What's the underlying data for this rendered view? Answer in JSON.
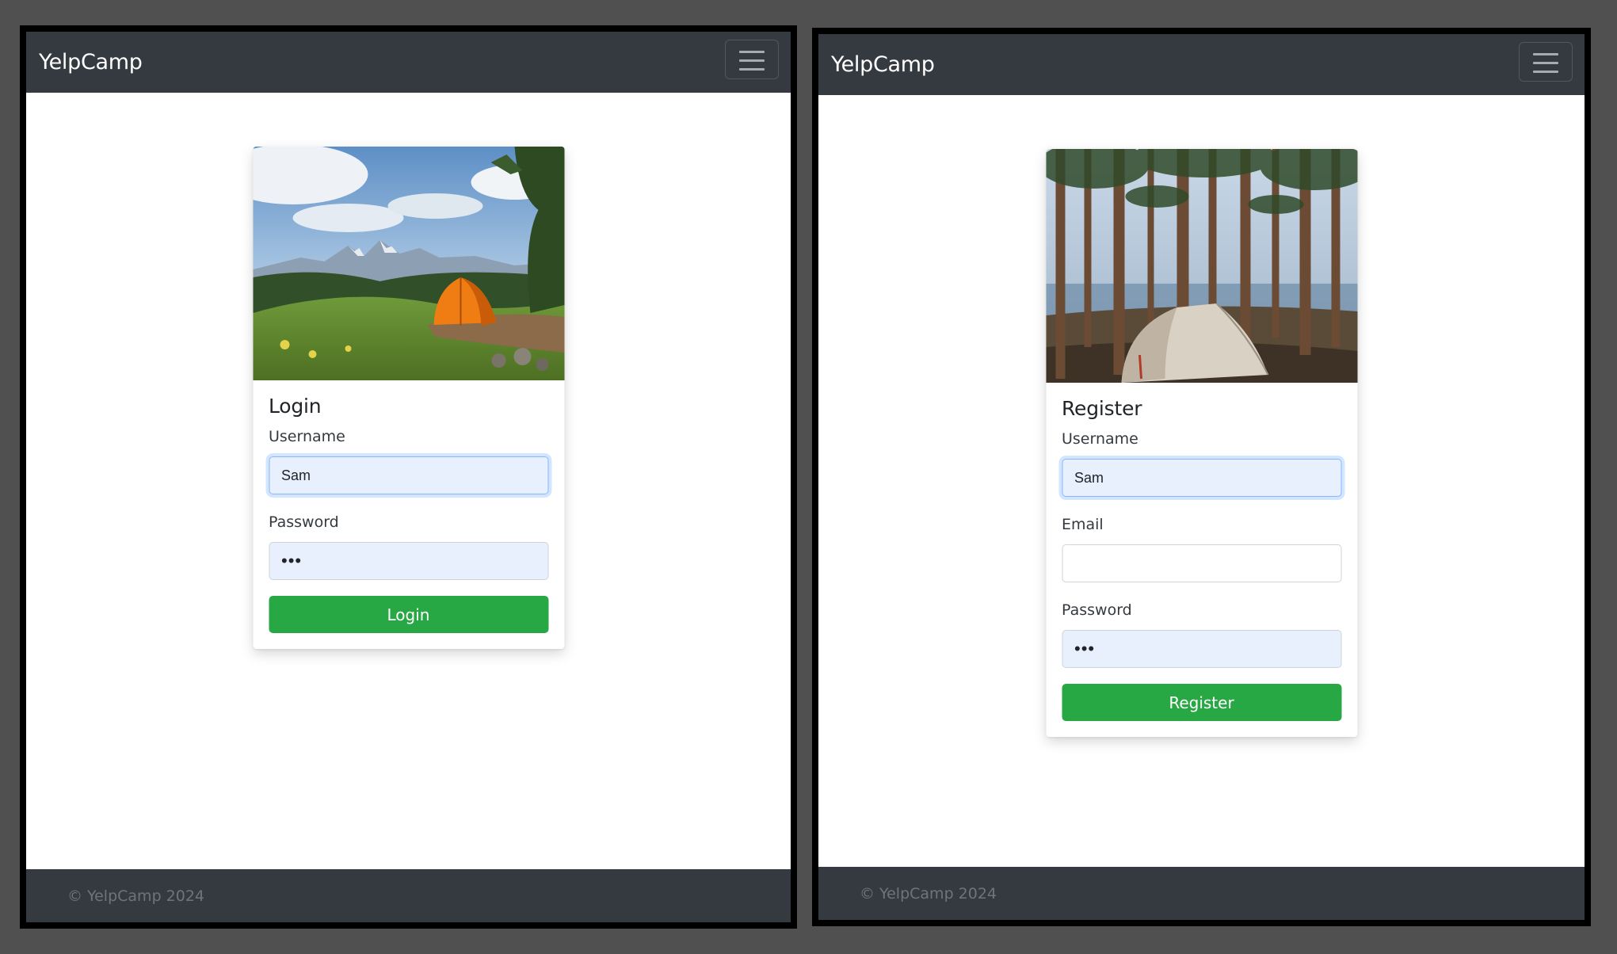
{
  "login_window": {
    "brand": "YelpCamp",
    "card": {
      "title": "Login",
      "username_label": "Username",
      "username_value": "Sam",
      "password_label": "Password",
      "password_value": "•••",
      "submit_label": "Login"
    },
    "footer": "© YelpCamp 2024"
  },
  "register_window": {
    "brand": "YelpCamp",
    "card": {
      "title": "Register",
      "username_label": "Username",
      "username_value": "Sam",
      "email_label": "Email",
      "email_value": "",
      "password_label": "Password",
      "password_value": "•••",
      "submit_label": "Register"
    },
    "footer": "© YelpCamp 2024"
  },
  "colors": {
    "navbar": "#343a40",
    "button_success": "#28a745",
    "autofill": "#e8f0fe",
    "backdrop": "#505050"
  },
  "icons": [
    "hamburger-menu-icon"
  ]
}
